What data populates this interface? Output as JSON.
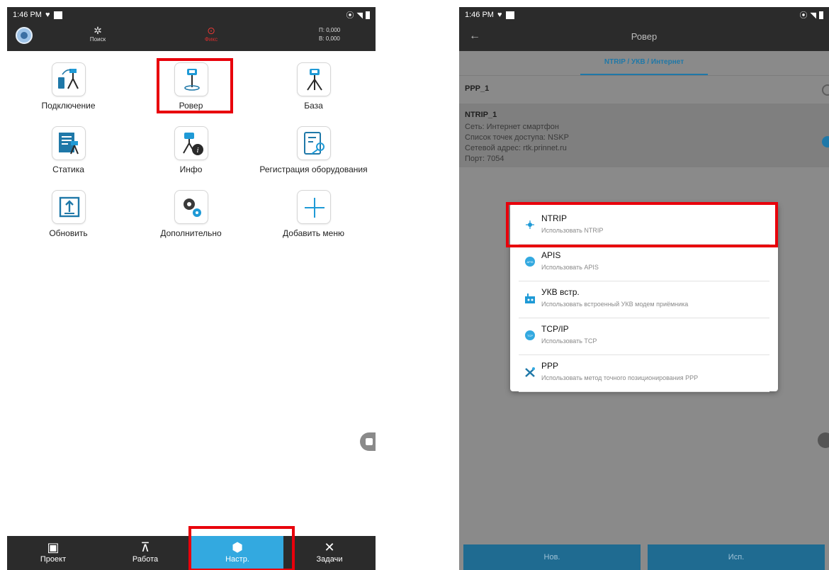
{
  "left": {
    "status": {
      "time": "1:46 PM"
    },
    "toolbar": {
      "search_label": "Поиск",
      "status_label": "Фикс",
      "coord_n": "П: 0,000",
      "coord_b": "В: 0,000"
    },
    "menu": [
      {
        "label": "Подключение",
        "icon": "connection-icon"
      },
      {
        "label": "Ровер",
        "icon": "rover-icon"
      },
      {
        "label": "База",
        "icon": "base-icon"
      },
      {
        "label": "Статика",
        "icon": "static-icon"
      },
      {
        "label": "Инфо",
        "icon": "info-icon"
      },
      {
        "label": "Регистрация оборудования",
        "icon": "registration-icon"
      },
      {
        "label": "Обновить",
        "icon": "update-icon"
      },
      {
        "label": "Дополнительно",
        "icon": "advanced-icon"
      },
      {
        "label": "Добавить меню",
        "icon": "add-icon"
      }
    ],
    "nav": [
      {
        "label": "Проект",
        "icon": "project-icon"
      },
      {
        "label": "Работа",
        "icon": "survey-icon"
      },
      {
        "label": "Настр.",
        "icon": "settings-icon",
        "active": true
      },
      {
        "label": "Задачи",
        "icon": "tools-icon"
      }
    ]
  },
  "right": {
    "status": {
      "time": "1:46 PM"
    },
    "title": "Ровер",
    "tab": "NTRIP / УКВ / Интернет",
    "ppp_name": "PPP_1",
    "ntrip": {
      "name": "NTRIP_1",
      "network": "Сеть:  Интернет смартфон",
      "mountpoint": "Список точек доступа:  NSKP",
      "address": "Сетевой адрес:  rtk.prinnet.ru",
      "port": "Порт:  7054"
    },
    "options": [
      {
        "title": "NTRIP",
        "subtitle": "Использовать NTRIP",
        "icon": "ntrip-icon"
      },
      {
        "title": "APIS",
        "subtitle": "Использовать APIS",
        "icon": "apis-icon"
      },
      {
        "title": "УКВ встр.",
        "subtitle": "Использовать встроенный УКВ модем приёмника",
        "icon": "radio-modem-icon"
      },
      {
        "title": "TCP/IP",
        "subtitle": "Использовать TCP",
        "icon": "tcp-icon"
      },
      {
        "title": "PPP",
        "subtitle": "Использовать метод точного позиционирования PPP",
        "icon": "ppp-icon"
      }
    ],
    "buttons": {
      "new": "Нов.",
      "use": "Исп."
    }
  },
  "colors": {
    "accent": "#33a9e0",
    "highlight": "#e8000b",
    "dark": "#2b2b2b"
  }
}
